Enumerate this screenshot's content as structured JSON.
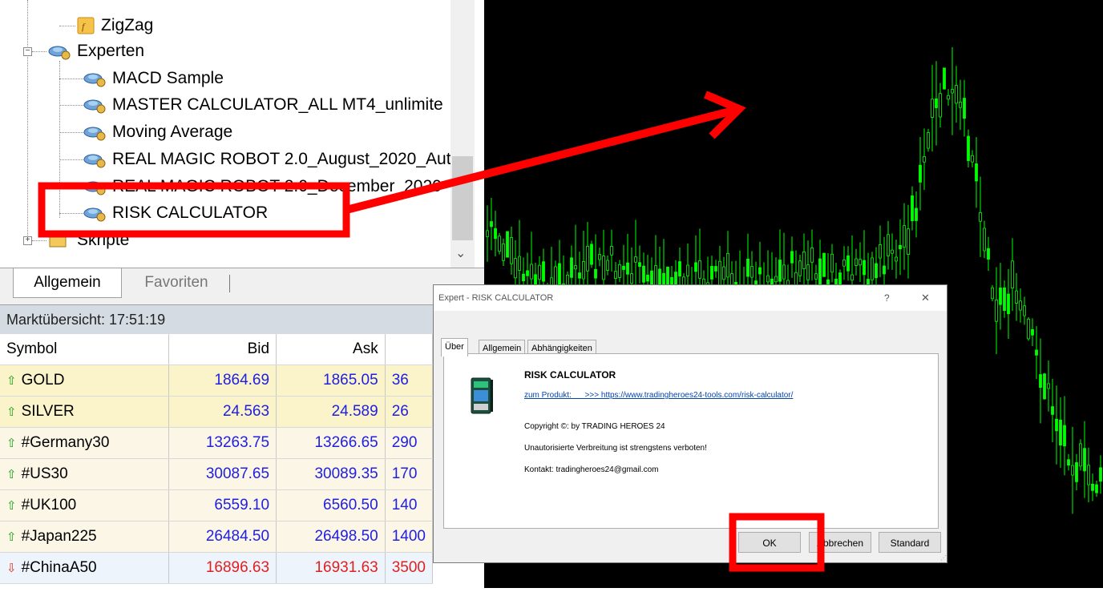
{
  "navigator": {
    "items": [
      {
        "label": "ZigZag",
        "icon": "indicator-icon"
      },
      {
        "label": "Experten",
        "icon": "expert-folder-icon"
      },
      {
        "label": "MACD Sample",
        "icon": "expert-icon"
      },
      {
        "label": "MASTER CALCULATOR_ALL MT4_unlimite",
        "icon": "expert-icon"
      },
      {
        "label": "Moving Average",
        "icon": "expert-icon"
      },
      {
        "label": "REAL MAGIC ROBOT 2.0_August_2020_Aut",
        "icon": "expert-icon"
      },
      {
        "label": "REAL MAGIC ROBOT 2.0_December_2020",
        "icon": "expert-icon"
      },
      {
        "label": "RISK CALCULATOR",
        "icon": "expert-icon"
      },
      {
        "label": "Skripte",
        "icon": "scripts-folder-icon"
      }
    ],
    "tabs": [
      "Allgemein",
      "Favoriten"
    ]
  },
  "market_watch": {
    "title": "Marktübersicht: 17:51:19",
    "columns": [
      "Symbol",
      "Bid",
      "Ask",
      ""
    ],
    "rows": [
      {
        "symbol": "GOLD",
        "bid": "1864.69",
        "ask": "1865.05",
        "spread": "36",
        "dir": "up"
      },
      {
        "symbol": "SILVER",
        "bid": "24.563",
        "ask": "24.589",
        "spread": "26",
        "dir": "up"
      },
      {
        "symbol": "#Germany30",
        "bid": "13263.75",
        "ask": "13266.65",
        "spread": "290",
        "dir": "up"
      },
      {
        "symbol": "#US30",
        "bid": "30087.65",
        "ask": "30089.35",
        "spread": "170",
        "dir": "up"
      },
      {
        "symbol": "#UK100",
        "bid": "6559.10",
        "ask": "6560.50",
        "spread": "140",
        "dir": "up"
      },
      {
        "symbol": "#Japan225",
        "bid": "26484.50",
        "ask": "26498.50",
        "spread": "1400",
        "dir": "up"
      },
      {
        "symbol": "#ChinaA50",
        "bid": "16896.63",
        "ask": "16931.63",
        "spread": "3500",
        "dir": "down"
      }
    ]
  },
  "dialog": {
    "title": "Expert - RISK CALCULATOR",
    "help": "?",
    "close": "✕",
    "tabs": [
      "Über",
      "Allgemein",
      "Abhängigkeiten"
    ],
    "product_name": "RISK CALCULATOR",
    "link": "zum Produkt:      >>> https://www.tradingheroes24-tools.com/risk-calculator/",
    "copyright": "Copyright ©: by TRADING HEROES 24",
    "notice": "Unautorisierte Verbreitung ist strengstens verboten!",
    "contact": "Kontakt: tradingheroes24@gmail.com",
    "buttons": {
      "ok": "OK",
      "cancel": "Abbrechen",
      "standard": "Standard"
    }
  },
  "colors": {
    "highlight": "#ff0000",
    "candles": "#00ff00",
    "chart_bg": "#000000",
    "bid_ask_up": "#2020e0",
    "bid_ask_down": "#e02020"
  }
}
